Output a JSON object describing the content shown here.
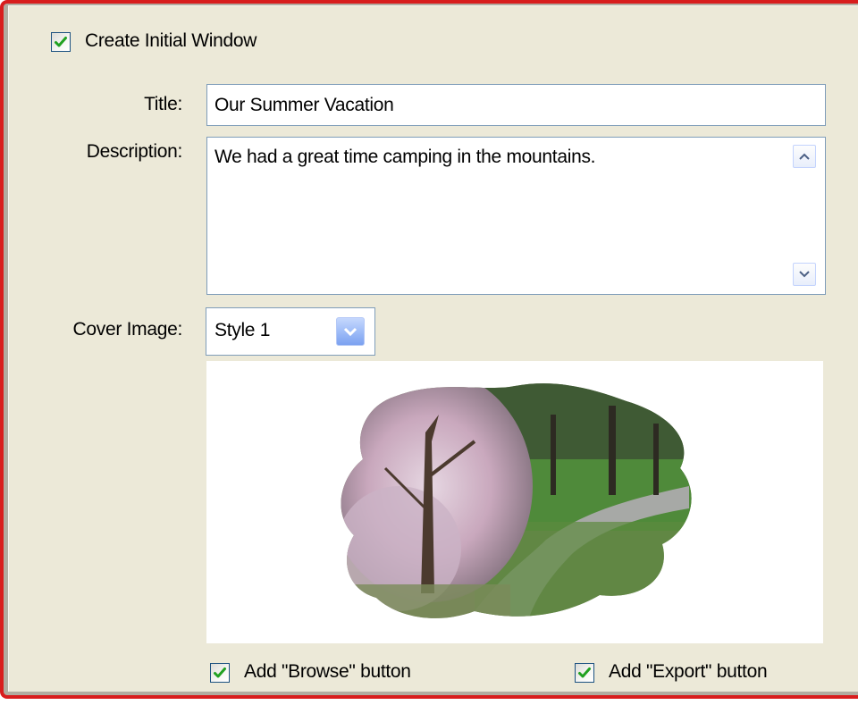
{
  "form": {
    "create_window": {
      "label": "Create Initial Window",
      "checked": true
    },
    "title": {
      "label": "Title:",
      "value": "Our Summer Vacation"
    },
    "description": {
      "label": "Description:",
      "value": "We had a great time camping in the mountains."
    },
    "cover_image": {
      "label": "Cover Image:",
      "selected": "Style 1"
    },
    "browse_button": {
      "label": "Add \"Browse\" button",
      "checked": true
    },
    "export_button": {
      "label": "Add \"Export\" button",
      "checked": true
    }
  },
  "colors": {
    "accent_border": "#d81d1d",
    "panel_bg": "#ece9d8",
    "checkmark": "#21a121",
    "field_border": "#7f9db9"
  },
  "icons": {
    "checkbox": "checkmark-icon",
    "scroll_up": "arrow-up-icon",
    "scroll_down": "arrow-down-icon",
    "dropdown": "chevron-down-icon"
  }
}
